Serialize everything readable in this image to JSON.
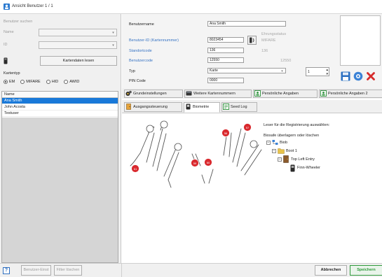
{
  "window": {
    "title": "Ansicht Benutzer 1 / 1"
  },
  "search": {
    "header": "Benutzer suchen",
    "name_label": "Name",
    "name_value": "",
    "id_label": "ID",
    "id_value": "",
    "read_card_button": "Kartendaten lesen",
    "card_type_label": "Kartentyp",
    "card_types": [
      "EM",
      "MIFARE",
      "HID",
      "AWID"
    ],
    "card_type_selected": "EM"
  },
  "user_list": {
    "column_header": "Name",
    "rows": [
      "Ana Smith",
      "John Acosta",
      "Testuser"
    ],
    "selected_index": 0
  },
  "form": {
    "username_label": "Benutzername",
    "username_value": "Ana Smith",
    "user_id_label": "Benutzer-ID (Kartennummer)",
    "user_id_value": "8023454",
    "site_code_label": "Standortcode",
    "site_code_value": "136",
    "user_code_label": "Benutzercode",
    "user_code_value": "12550",
    "type_label": "Typ",
    "type_value": "Karte",
    "pin_label": "PIN Code",
    "pin_value": "0000",
    "spinner_value": "1",
    "hint_1": "Ehrungsstatus",
    "hint_2": "MIFARE",
    "hint_3": "136",
    "hint_4": "12550"
  },
  "tabs_row1": [
    "Grundeinstellungen",
    "Weitere Kartennummern",
    "Persönliche Angaben",
    "Persönliche Angaben 2"
  ],
  "tabs_row2": [
    "Ausgangssteuerung",
    "Biometrie",
    "Seed Log"
  ],
  "active_tab": "Biometrie",
  "biometrics": {
    "instruction": "Leser für die Registrierung auswählen:",
    "recording_hint": "Biosafe überlagern oder löschen",
    "finger_numbers": [
      "61",
      "59",
      "60",
      "56",
      "57"
    ],
    "tree": {
      "root": "Biob",
      "level1": "Boot 1",
      "level2": "Top Left Entry",
      "level3": "Finn-Wheeler"
    }
  },
  "actions": {
    "save_fingerprint": "Benutzer-Einst",
    "delete_fingerprint": "Filter löschen",
    "cancel": "Abbrechen",
    "save": "Speichern"
  },
  "colors": {
    "selection": "#1979d9",
    "finger_enrolled": "#d9292e",
    "link_blue": "#3874c4",
    "save_green": "#2f9a3c"
  }
}
